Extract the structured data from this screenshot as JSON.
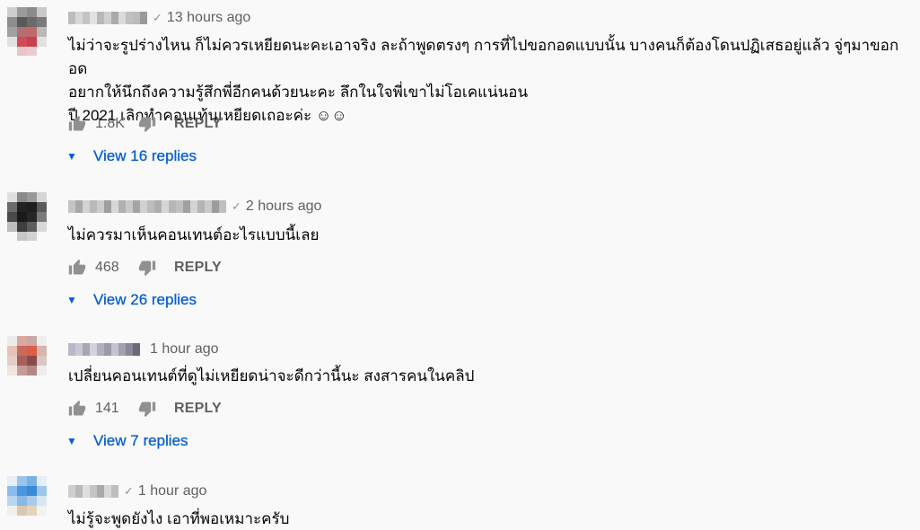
{
  "comments": [
    {
      "verified_mark": "✓",
      "time": "13 hours ago",
      "text": "ไม่ว่าจะรูปร่างไหน ก็ไม่ควรเหยียดนะคะเอาจริง ละถ้าพูดตรงๆ การที่ไปขอกอดแบบนั้น บางคนก็ต้องโดนปฏิเสธอยู่แล้ว  จู่ๆมาขอกอด\nอยากให้นึกถึงความรู้สึกพี่อีกคนด้วยนะคะ ลึกในใจพี่เขาไม่โอเคแน่นอน\nปี 2021 เลิกทำคอนเท้นเหยียดเถอะค่ะ ☺☺",
      "likes": "1.8K",
      "reply_label": "REPLY",
      "replies_label": "View 16 replies"
    },
    {
      "verified_mark": "✓",
      "time": "2 hours ago",
      "text": "ไม่ควรมาเห็นคอนเทนต์อะไรแบบนี้เลย",
      "likes": "468",
      "reply_label": "REPLY",
      "replies_label": "View 26 replies"
    },
    {
      "verified_mark": "",
      "time": "1 hour ago",
      "text": "เปลี่ยนคอนเทนต์ที่ดูไม่เหยียดน่าจะดีกว่านี้นะ สงสารคนในคลิป",
      "likes": "141",
      "reply_label": "REPLY",
      "replies_label": "View 7 replies"
    },
    {
      "verified_mark": "✓",
      "time": "1 hour ago",
      "text": "ไม่รู้จะพูดยังไง เอาที่พอเหมาะครับ"
    }
  ],
  "colors": {
    "link": "#065fd4",
    "secondary_text": "#606060",
    "background": "#f9f9f9"
  },
  "icons": {
    "like": "thumb-up-icon",
    "dislike": "thumb-down-icon",
    "expand": "caret-down-icon"
  }
}
